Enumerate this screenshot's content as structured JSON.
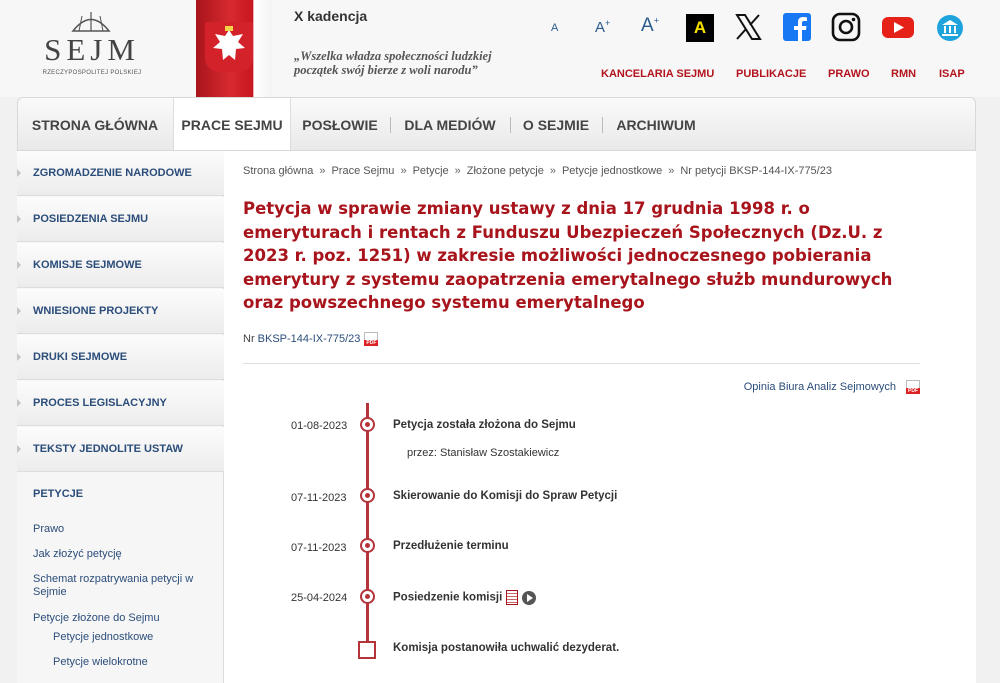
{
  "header": {
    "logo_word": "SEJM",
    "logo_sub": "RZECZYPOSPOLITEJ POLSKIEJ",
    "kadencja": "X kadencja",
    "motto": "„Wszelka władza społeczności ludzkiej początek swój bierze z woli narodu”",
    "font_small": "A",
    "font_medium": "A",
    "font_large": "A",
    "font_plus": "+",
    "contrast": "A",
    "links": [
      "KANCELARIA SEJMU",
      "PUBLIKACJE",
      "PRAWO",
      "RMN",
      "ISAP"
    ]
  },
  "nav": {
    "items": [
      "STRONA GŁÓWNA",
      "PRACE SEJMU",
      "POSŁOWIE",
      "DLA MEDIÓW",
      "O SEJMIE",
      "ARCHIWUM"
    ],
    "active": "PRACE SEJMU"
  },
  "sidebar": {
    "items": [
      "ZGROMADZENIE NARODOWE",
      "POSIEDZENIA SEJMU",
      "KOMISJE SEJMOWE",
      "WNIESIONE PROJEKTY",
      "DRUKI SEJMOWE",
      "PROCES LEGISLACYJNY",
      "TEKSTY JEDNOLITE USTAW"
    ],
    "section": "PETYCJE",
    "links": [
      "Prawo",
      "Jak złożyć petycję",
      "Schemat rozpatrywania petycji w Sejmie",
      "Petycje złożone do Sejmu",
      "Petycje jednostkowe",
      "Petycje wielokrotne"
    ]
  },
  "breadcrumb": [
    "Strona główna",
    "Prace Sejmu",
    "Petycje",
    "Złożone petycje",
    "Petycje jednostkowe",
    "Nr petycji BKSP-144-IX-775/23"
  ],
  "breadcrumb_sep": "»",
  "main": {
    "title": "Petycja w sprawie zmiany ustawy z dnia 17 grudnia 1998 r. o emeryturach i rentach z Funduszu Ubezpieczeń Społecznych (Dz.U. z 2023 r. poz. 1251) w zakresie możliwości jednoczesnego pobierania emerytury z systemu zaopatrzenia emerytalnego służb mundurowych oraz powszechnego systemu emerytalnego",
    "nr_label": "Nr",
    "nr_value": "BKSP-144-IX-775/23",
    "opinia": "Opinia Biura Analiz Sejmowych"
  },
  "timeline": [
    {
      "date": "01-08-2023",
      "event": "Petycja została złożona do Sejmu",
      "sub": "przez: Stanisław Szostakiewicz"
    },
    {
      "date": "07-11-2023",
      "event": "Skierowanie do Komisji do Spraw Petycji"
    },
    {
      "date": "07-11-2023",
      "event": "Przedłużenie terminu"
    },
    {
      "date": "25-04-2024",
      "event": "Posiedzenie komisji"
    },
    {
      "event": "Komisja postanowiła uchwalić dezyderat."
    }
  ],
  "colors": {
    "accent": "#a8141b",
    "link": "#2b4d7a",
    "timeline": "#b5333a"
  }
}
